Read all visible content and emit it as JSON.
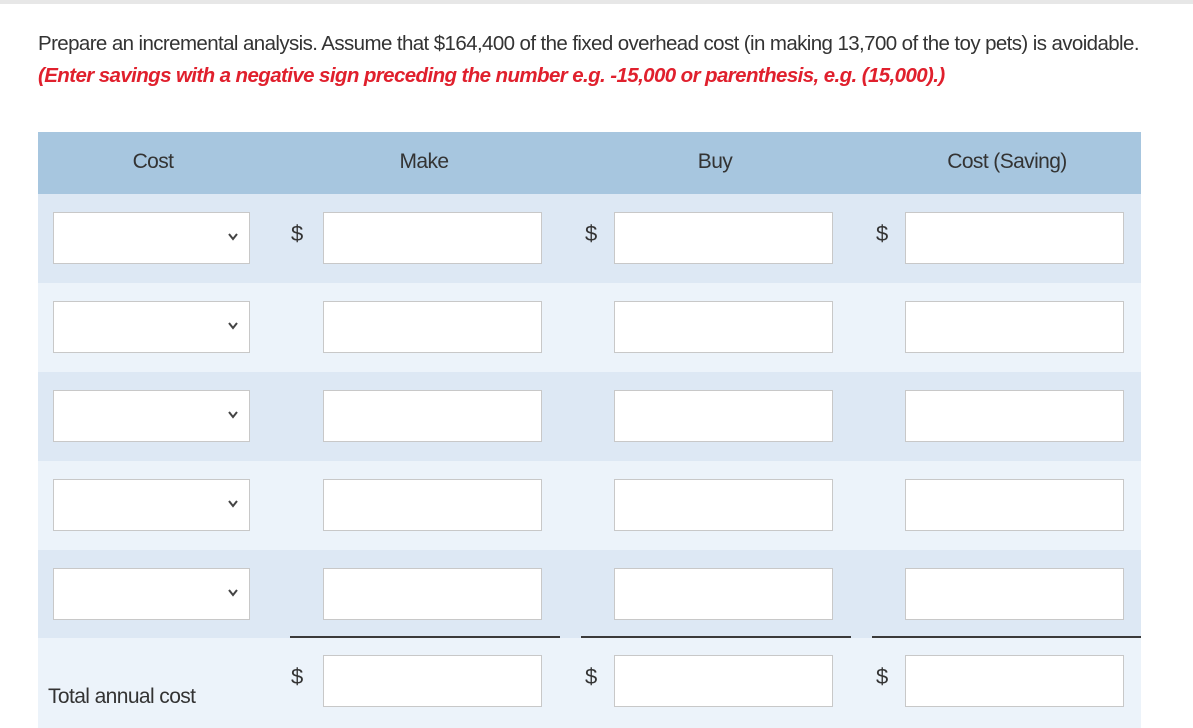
{
  "instructions": {
    "main_text": "Prepare an incremental analysis. Assume that $164,400 of the fixed overhead cost (in making 13,700 of the toy pets) is avoidable. ",
    "hint_text": "(Enter savings with a negative sign preceding the number e.g. -15,000 or parenthesis, e.g. (15,000).)"
  },
  "table": {
    "headers": {
      "cost": "Cost",
      "make": "Make",
      "buy": "Buy",
      "cost_saving": "Cost (Saving)"
    },
    "currency_symbol": "$",
    "rows": [
      {
        "cost_selected": "",
        "make_value": "",
        "buy_value": "",
        "cost_saving_value": ""
      },
      {
        "cost_selected": "",
        "make_value": "",
        "buy_value": "",
        "cost_saving_value": ""
      },
      {
        "cost_selected": "",
        "make_value": "",
        "buy_value": "",
        "cost_saving_value": ""
      },
      {
        "cost_selected": "",
        "make_value": "",
        "buy_value": "",
        "cost_saving_value": ""
      },
      {
        "cost_selected": "",
        "make_value": "",
        "buy_value": "",
        "cost_saving_value": ""
      }
    ],
    "total_row": {
      "label": "Total annual cost",
      "make_value": "",
      "buy_value": "",
      "cost_saving_value": ""
    }
  },
  "colors": {
    "header_bg": "#a7c6df",
    "row_shade_dark": "#dde8f4",
    "row_shade_light": "#ecf3fa",
    "hint_text": "#e0202d"
  },
  "icons": {
    "select_arrow": "chevron-down-icon"
  }
}
